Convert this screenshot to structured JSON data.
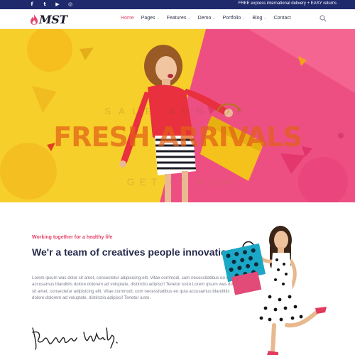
{
  "topbar": {
    "social": [
      {
        "icon": "facebook-icon",
        "glyph": "f"
      },
      {
        "icon": "twitter-icon",
        "glyph": "t"
      },
      {
        "icon": "youtube-icon",
        "glyph": "▶"
      },
      {
        "icon": "instagram-icon",
        "glyph": "◎"
      }
    ],
    "promo": "FREE express international delivery + EASY returns",
    "background": "#1f2a6d"
  },
  "nav": {
    "logo_text": "MST",
    "items": [
      {
        "label": "Home",
        "active": true,
        "dropdown": false
      },
      {
        "label": "Pages",
        "active": false,
        "dropdown": true
      },
      {
        "label": "Features",
        "active": false,
        "dropdown": true
      },
      {
        "label": "Demo",
        "active": false,
        "dropdown": true
      },
      {
        "label": "Portfolio",
        "active": false,
        "dropdown": true
      },
      {
        "label": "Blog",
        "active": false,
        "dropdown": true
      },
      {
        "label": "Contact",
        "active": false,
        "dropdown": false
      }
    ],
    "chevron_glyph": "⌄",
    "accent": "#e5456b"
  },
  "hero": {
    "sale_text": "SALE 40% OF",
    "headline": "FRESH ARRIVALS",
    "cta_label": "GET IT NOW",
    "colors": {
      "yellow": "#f7cf2a",
      "pink": "#ee4f83"
    }
  },
  "about": {
    "tagline": "Working together for a healthy life",
    "title": "We'r a team of creatives people innovation.",
    "body": "Lorem ipsum was dolor sit amet, consectetur adipisicing elit. Vitae commodi, cum necessitatibus eo quia accusamus blanditiis dolore dolorem ad voluptate, distinctio adipisci! Tenetur iusto.Lorem ipsum was dolor sit amet, consectetur adipisicing elit. Vitae commodi, cum necessitatibus eo quia accusamus blanditiis dolore dolorem ad voluptate, distinctio adipisci! Tenetur iusto.",
    "title_color": "#252a4a"
  }
}
